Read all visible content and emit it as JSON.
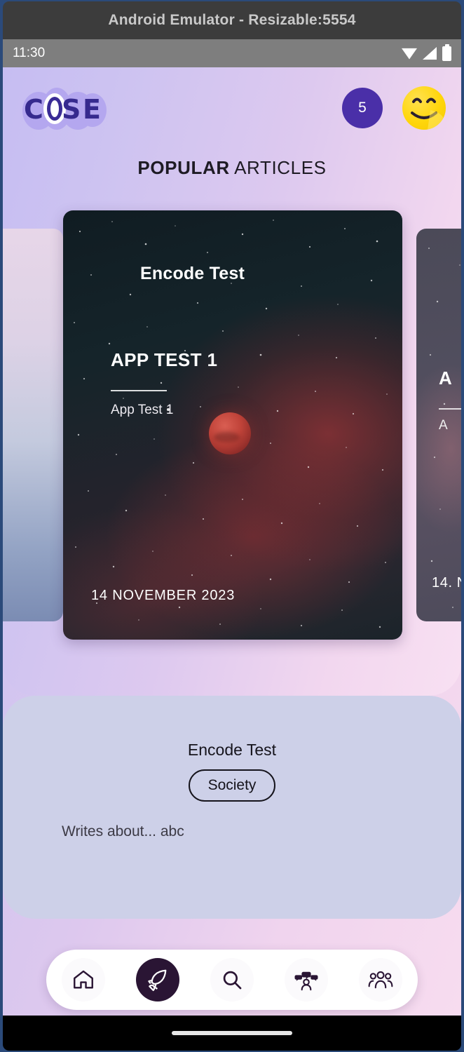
{
  "emulator": {
    "window_title": "Android Emulator - Resizable:5554"
  },
  "status_bar": {
    "time": "11:30",
    "icons": [
      "wifi-icon",
      "cellular-signal-icon",
      "battery-icon"
    ]
  },
  "header": {
    "logo_text": "COSE",
    "logo_letters": [
      "C",
      "O",
      "S",
      "E"
    ],
    "notification_count": "5",
    "avatar_icon": "smiley-face-avatar",
    "accent_color": "#4a2fa8",
    "avatar_color": "#ffd60b"
  },
  "section": {
    "title_bold": "POPULAR",
    "title_regular": "ARTICLES"
  },
  "carousel": {
    "cards": [
      {
        "position": "left-peek",
        "title": "",
        "heading": "",
        "subtitle": "",
        "date": ""
      },
      {
        "position": "center-active",
        "title": "Encode Test",
        "heading": "APP TEST 1",
        "subtitle": "App Test 1",
        "date": "14 NOVEMBER 2023"
      },
      {
        "position": "right-peek",
        "title": "",
        "heading": "A",
        "subtitle": "A",
        "date": "14. N"
      }
    ]
  },
  "author": {
    "name": "Encode Test",
    "category_chip": "Society",
    "writes_about": "Writes about... abc"
  },
  "bottom_nav": {
    "items": [
      {
        "name": "home-icon",
        "label": "Home",
        "active": false
      },
      {
        "name": "rocket-icon",
        "label": "Explore",
        "active": true
      },
      {
        "name": "search-icon",
        "label": "Search",
        "active": false
      },
      {
        "name": "profile-notifications-icon",
        "label": "Profile",
        "active": false
      },
      {
        "name": "community-icon",
        "label": "Community",
        "active": false
      }
    ],
    "active_bg": "#2a1534"
  },
  "system_nav": {
    "gesture_handle": "home-gesture-pill"
  }
}
